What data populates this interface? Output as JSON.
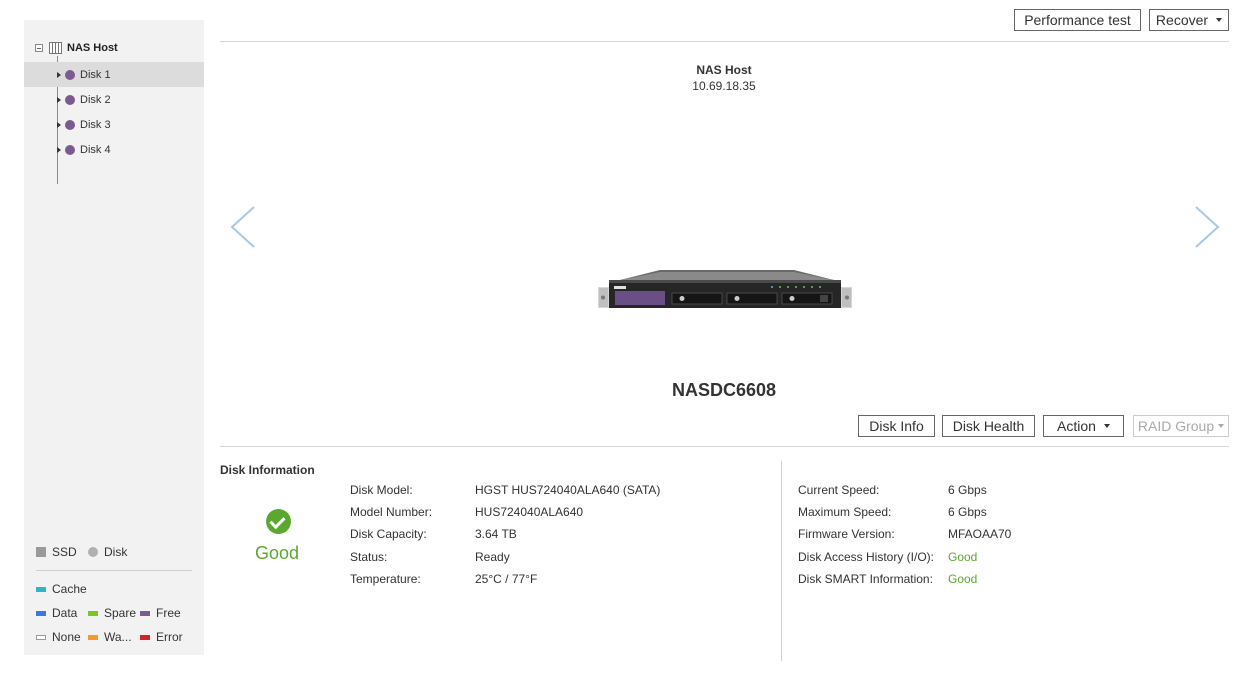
{
  "tree": {
    "root_label": "NAS Host",
    "disks": [
      {
        "label": "Disk 1",
        "selected": true
      },
      {
        "label": "Disk 2",
        "selected": false
      },
      {
        "label": "Disk 3",
        "selected": false
      },
      {
        "label": "Disk 4",
        "selected": false
      }
    ]
  },
  "legend": {
    "ssd": "SSD",
    "disk": "Disk",
    "cache": "Cache",
    "data": "Data",
    "spare": "Spare",
    "free": "Free",
    "none": "None",
    "warning": "Wa...",
    "error": "Error",
    "colors": {
      "cache": "#2bb5c5",
      "data": "#3b78e0",
      "spare": "#7cc624",
      "free": "#7a5a90",
      "none": "#ffffff",
      "warning": "#f39a2b",
      "error": "#d02626"
    }
  },
  "toolbar": {
    "performance_test": "Performance test",
    "recover": "Recover"
  },
  "host": {
    "name": "NAS Host",
    "ip": "10.69.18.35",
    "model": "NASDC6608"
  },
  "actions": {
    "disk_info": "Disk Info",
    "disk_health": "Disk Health",
    "action": "Action",
    "raid_group": "RAID Group"
  },
  "disk_info": {
    "title": "Disk Information",
    "health": "Good",
    "left": [
      {
        "label": "Disk Model:",
        "value": "HGST HUS724040ALA640 (SATA)"
      },
      {
        "label": "Model Number:",
        "value": "HUS724040ALA640"
      },
      {
        "label": "Disk Capacity:",
        "value": "3.64 TB"
      },
      {
        "label": "Status:",
        "value": "Ready"
      },
      {
        "label": "Temperature:",
        "value": "25°C / 77°F"
      }
    ],
    "right": [
      {
        "label": "Current Speed:",
        "value": "6 Gbps"
      },
      {
        "label": "Maximum Speed:",
        "value": "6 Gbps"
      },
      {
        "label": "Firmware Version:",
        "value": "MFAOAA70"
      },
      {
        "label": "Disk Access History (I/O):",
        "value": "Good"
      },
      {
        "label": "Disk SMART Information:",
        "value": "Good"
      }
    ]
  },
  "colors": {
    "accent_green": "#5aa830",
    "disk_purple": "#7a5a90"
  }
}
